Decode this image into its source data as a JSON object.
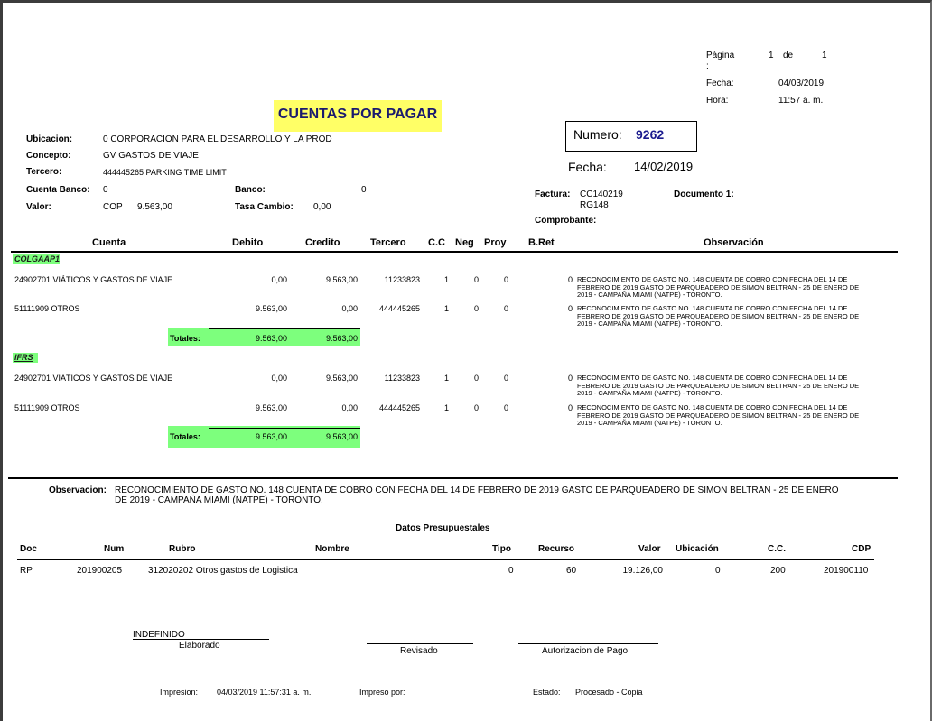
{
  "header": {
    "pagina_label": "Página",
    "pagina_colon": ":",
    "pagina_num": "1",
    "de_label": "de",
    "pagina_total": "1",
    "fecha_label": "Fecha:",
    "fecha_value": "04/03/2019",
    "hora_label": "Hora:",
    "hora_value": "11:57 a. m."
  },
  "title": "CUENTAS POR PAGAR",
  "numero": {
    "label": "Numero:",
    "value": "9262"
  },
  "fecha_doc": {
    "label": "Fecha:",
    "value": "14/02/2019"
  },
  "info": {
    "ubicacion_label": "Ubicacion:",
    "ubicacion_value": "0  CORPORACION PARA EL DESARROLLO Y LA PROD",
    "concepto_label": "Concepto:",
    "concepto_value": "GV   GASTOS DE VIAJE",
    "tercero_label": "Tercero:",
    "tercero_value": "444445265   PARKING TIME LIMIT",
    "cuenta_banco_label": "Cuenta Banco:",
    "cuenta_banco_value": "0",
    "banco_label": "Banco:",
    "banco_value": "0",
    "valor_label": "Valor:",
    "valor_moneda": "COP",
    "valor_value": "9.563,00",
    "tasa_label": "Tasa Cambio:",
    "tasa_value": "0,00",
    "factura_label": "Factura:",
    "factura_value_1": "CC140219",
    "factura_value_2": "RG148",
    "documento_label": "Documento 1:",
    "comprobante_label": "Comprobante:"
  },
  "columns": {
    "cuenta": "Cuenta",
    "debito": "Debito",
    "credito": "Credito",
    "tercero": "Tercero",
    "cc": "C.C",
    "neg": "Neg",
    "proy": "Proy",
    "bret": "B.Ret",
    "observacion": "Observación"
  },
  "sections": [
    {
      "name": "COLGAAP1",
      "rows": [
        {
          "cuenta": "24902701  VIÁTICOS Y GASTOS DE VIAJE",
          "debito": "0,00",
          "credito": "9.563,00",
          "tercero": "11233823",
          "cc": "1",
          "neg": "0",
          "proy": "0",
          "bret": "0",
          "obs": [
            "RECONOCIMIENTO DE GASTO NO. 148 CUENTA DE COBRO CON FECHA DEL 14 DE",
            "FEBRERO DE 2019 GASTO DE PARQUEADERO DE SIMON BELTRAN - 25 DE ENERO DE",
            "2019 - CAMPAÑA MIAMI (NATPE) - TORONTO."
          ]
        },
        {
          "cuenta": "51111909  OTROS",
          "debito": "9.563,00",
          "credito": "0,00",
          "tercero": "444445265",
          "cc": "1",
          "neg": "0",
          "proy": "0",
          "bret": "0",
          "obs": [
            "RECONOCIMIENTO DE GASTO NO. 148 CUENTA DE COBRO CON FECHA DEL 14 DE",
            "FEBRERO DE 2019 GASTO DE PARQUEADERO DE SIMON BELTRAN - 25 DE ENERO DE",
            "2019 - CAMPAÑA MIAMI (NATPE) - TORONTO."
          ]
        }
      ],
      "totales_label": "Totales:",
      "total_debito": "9.563,00",
      "total_credito": "9.563,00"
    },
    {
      "name": "IFRS",
      "rows": [
        {
          "cuenta": "24902701  VIÁTICOS Y GASTOS DE VIAJE",
          "debito": "0,00",
          "credito": "9.563,00",
          "tercero": "11233823",
          "cc": "1",
          "neg": "0",
          "proy": "0",
          "bret": "0",
          "obs": [
            "RECONOCIMIENTO DE GASTO NO. 148 CUENTA DE COBRO CON FECHA DEL 14 DE",
            "FEBRERO DE 2019 GASTO DE PARQUEADERO DE SIMON BELTRAN - 25 DE ENERO DE",
            "2019 - CAMPAÑA MIAMI (NATPE) - TORONTO."
          ]
        },
        {
          "cuenta": "51111909  OTROS",
          "debito": "9.563,00",
          "credito": "0,00",
          "tercero": "444445265",
          "cc": "1",
          "neg": "0",
          "proy": "0",
          "bret": "0",
          "obs": [
            "RECONOCIMIENTO DE GASTO NO. 148 CUENTA DE COBRO CON FECHA DEL 14 DE",
            "FEBRERO DE 2019 GASTO DE PARQUEADERO DE SIMON BELTRAN - 25 DE ENERO DE",
            "2019 - CAMPAÑA MIAMI (NATPE) - TORONTO."
          ]
        }
      ],
      "totales_label": "Totales:",
      "total_debito": "9.563,00",
      "total_credito": "9.563,00"
    }
  ],
  "observacion": {
    "label": "Observacion:",
    "line1": "RECONOCIMIENTO DE GASTO NO. 148 CUENTA DE COBRO CON FECHA DEL 14 DE FEBRERO DE 2019 GASTO DE PARQUEADERO DE SIMON BELTRAN - 25 DE ENERO",
    "line2": "DE 2019 - CAMPAÑA MIAMI (NATPE) - TORONTO."
  },
  "presupuestal": {
    "title": "Datos Presupuestales",
    "columns": {
      "doc": "Doc",
      "num": "Num",
      "rubro": "Rubro",
      "nombre": "Nombre",
      "tipo": "Tipo",
      "recurso": "Recurso",
      "valor": "Valor",
      "ubicacion": "Ubicación",
      "cc": "C.C.",
      "cdp": "CDP"
    },
    "row": {
      "doc": "RP",
      "num": "201900205",
      "rubro": "312020202  Otros gastos de Logistica",
      "tipo": "0",
      "recurso": "60",
      "valor": "19.126,00",
      "ubicacion": "0",
      "cc": "200",
      "cdp": "201900110"
    }
  },
  "firmas": {
    "elaborado_nombre": "INDEFINIDO",
    "elaborado_label": "Elaborado",
    "revisado_label": "Revisado",
    "autorizacion_label": "Autorizacion de Pago"
  },
  "footer": {
    "impresion_label": "Impresion:",
    "impresion_value": "04/03/2019 11:57:31 a. m.",
    "impreso_por_label": "Impreso por:",
    "estado_label": "Estado:",
    "estado_value": "Procesado - Copia"
  },
  "colors": {
    "title_bg": "#ffff66",
    "title_text": "#1a1a6e",
    "numero_value": "#1a1a8e",
    "totals_bg": "#7dff7d"
  }
}
